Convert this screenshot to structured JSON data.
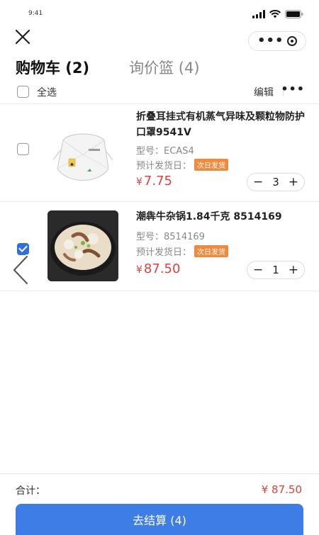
{
  "status_bar": {
    "time": "9:41"
  },
  "tabs": [
    {
      "label": "购物车 (2)",
      "active": true
    },
    {
      "label": "询价篮 (4)",
      "active": false
    }
  ],
  "toolbar": {
    "select_all_label": "全选",
    "edit_label": "编辑"
  },
  "items": [
    {
      "title": "折叠耳挂式有机蒸气异味及颗粒物防护口罩9541V",
      "model_label": "型号：",
      "model": "ECAS4",
      "ship_label": "预计发货日：",
      "ship_badge": "次日发货",
      "currency": "¥",
      "price": "7.75",
      "quantity": "3",
      "checked": false,
      "thumb_icon": "respirator-mask-image"
    },
    {
      "title": "潮犇牛杂锅1.84千克 8514169",
      "model_label": "型号：",
      "model": "8514169",
      "ship_label": "预计发货日：",
      "ship_badge": "次日发货",
      "currency": "¥",
      "price": "87.50",
      "quantity": "1",
      "checked": true,
      "thumb_icon": "beef-hotpot-image"
    }
  ],
  "stepper_symbols": {
    "minus": "−",
    "plus": "+"
  },
  "footer": {
    "total_label": "合计：",
    "total_value": "¥ 87.50",
    "checkout_label": "去结算 (4)"
  },
  "colors": {
    "accent": "#3d7de5",
    "price": "#e0413c",
    "badge": "#f08a3c"
  }
}
